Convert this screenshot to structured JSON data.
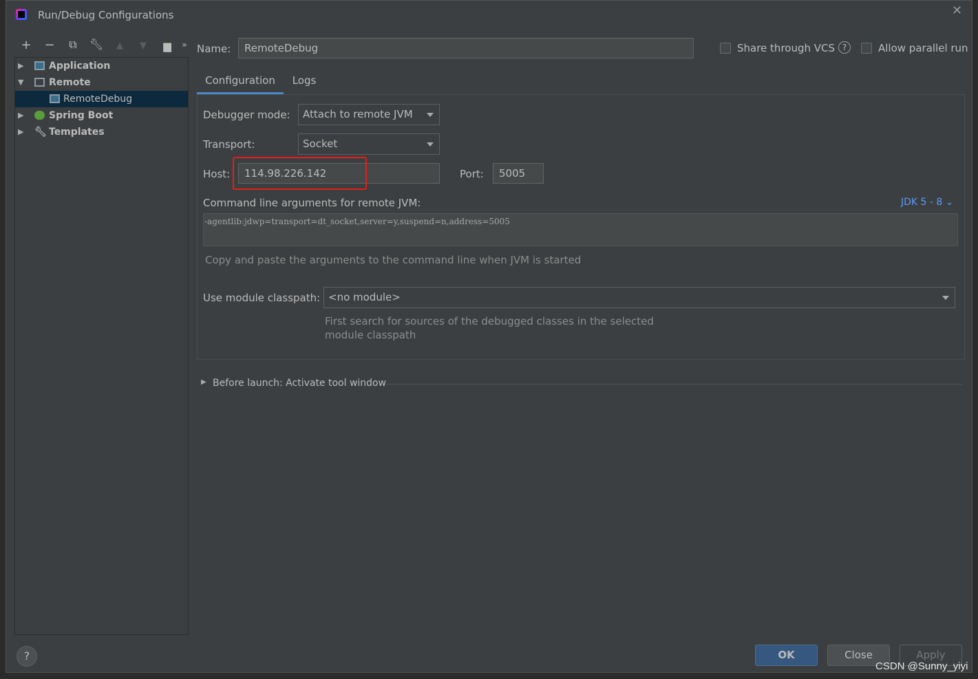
{
  "window": {
    "title": "Run/Debug Configurations"
  },
  "toolbar": [
    "add-icon",
    "remove-icon",
    "copy-icon",
    "wrench-icon",
    "move-up-icon",
    "move-down-icon",
    "new-folder-icon",
    "more-icon"
  ],
  "tree": [
    {
      "label": "Application",
      "expanded": false
    },
    {
      "label": "Remote",
      "expanded": true
    },
    {
      "label": "RemoteDebug",
      "selected": true
    },
    {
      "label": "Spring Boot",
      "expanded": false
    },
    {
      "label": "Templates",
      "expanded": false
    }
  ],
  "name": {
    "label": "Name:",
    "value": "RemoteDebug"
  },
  "share_vcs": {
    "label": "Share through VCS",
    "checked": false
  },
  "parallel": {
    "label": "Allow parallel run",
    "checked": false
  },
  "tabs": [
    {
      "label": "Configuration",
      "active": true
    },
    {
      "label": "Logs"
    }
  ],
  "config": {
    "debugger_mode_label": "Debugger mode:",
    "debugger_mode": "Attach to remote JVM",
    "transport_label": "Transport:",
    "transport": "Socket",
    "host_label": "Host:",
    "host": "114.98.226.142",
    "port_label": "Port:",
    "port": "5005",
    "cmd_label": "Command line arguments for remote JVM:",
    "jdk": "JDK 5 - 8",
    "cmd": "-agentlib:jdwp=transport=dt_socket,server=y,suspend=n,address=5005",
    "cmd_hint": "Copy and paste the arguments to the command line when JVM is started",
    "module_label": "Use module classpath:",
    "module": "<no module>",
    "module_hint_1": "First search for sources of the debugged classes in the selected",
    "module_hint_2": "module classpath"
  },
  "before_launch": "Before launch: Activate tool window",
  "buttons": {
    "ok": "OK",
    "close": "Close",
    "apply": "Apply"
  },
  "watermark": "CSDN @Sunny_yiyi",
  "colors": {
    "accent": "#365880",
    "highlight": "#e0201b",
    "link": "#589df6"
  }
}
